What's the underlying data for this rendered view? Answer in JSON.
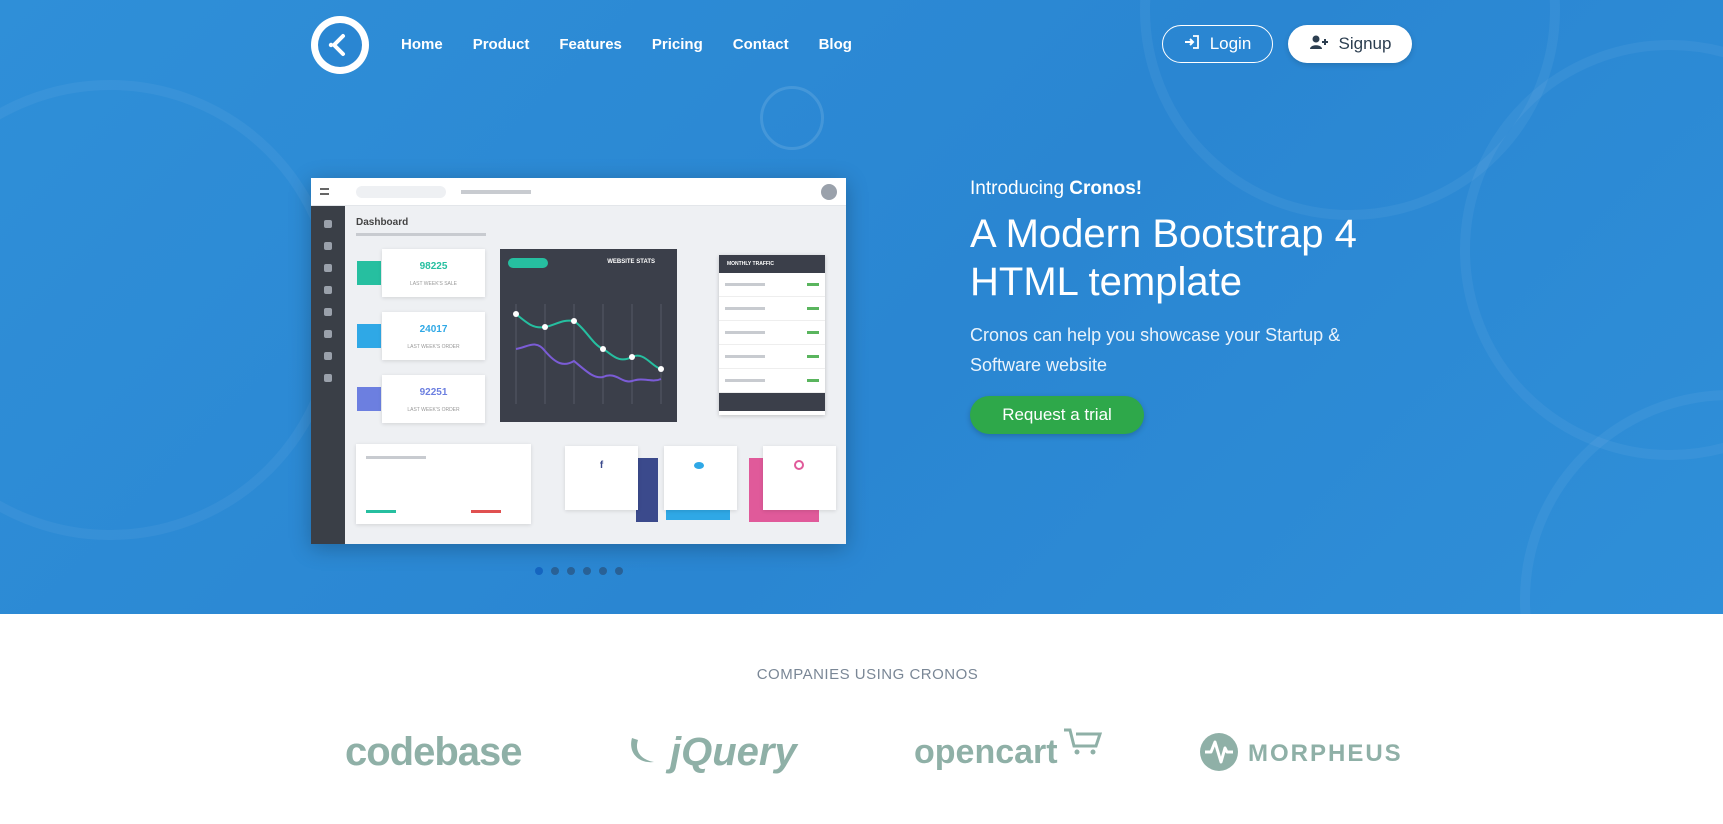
{
  "nav": {
    "brand_icon": "chevron-left-icon",
    "links": [
      "Home",
      "Product",
      "Features",
      "Pricing",
      "Contact",
      "Blog"
    ],
    "login_label": "Login",
    "signup_label": "Signup"
  },
  "hero": {
    "intro_prefix": "Introducing ",
    "intro_brand": "Cronos!",
    "headline": "A Modern Bootstrap 4 HTML template",
    "description": "Cronos can help you showcase your Startup & Software website",
    "cta_label": "Request a trial"
  },
  "mockup": {
    "dashboard_title": "Dashboard",
    "stats": [
      "98225",
      "24017",
      "92251"
    ],
    "chart_title": "WEBSITE STATS",
    "traffic_title": "MONTHLY TRAFFIC"
  },
  "carousel": {
    "count": 6,
    "active": 0
  },
  "companies": {
    "title": "COMPANIES USING CRONOS",
    "logos": [
      "codebase",
      "jQuery",
      "opencart",
      "MORPHEUS"
    ]
  },
  "colors": {
    "hero_bg": "#2a86d2",
    "cta": "#2ea84a",
    "logo_tint": "#8fb0a7"
  }
}
